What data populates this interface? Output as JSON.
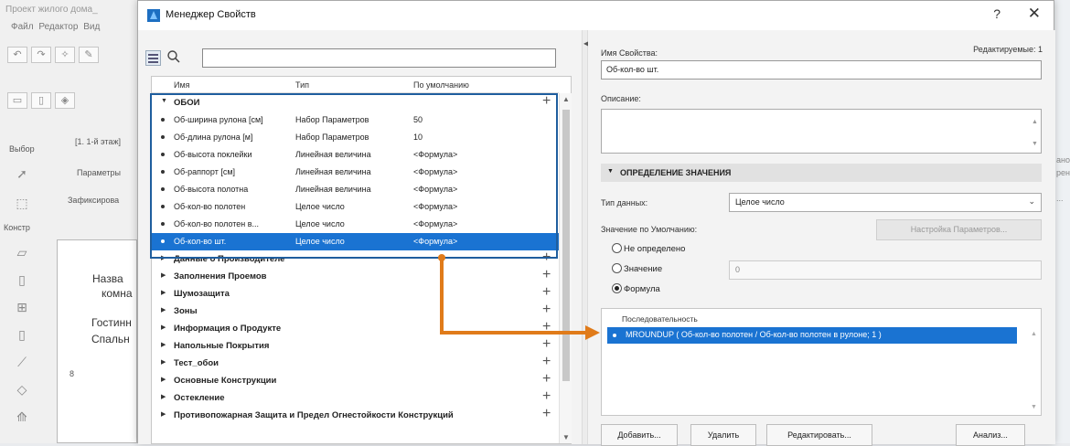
{
  "background": {
    "title": "Проект жилого дома_",
    "menu": "Файл  Редактор  Вид",
    "toolbar_icons": [
      "undo-icon",
      "redo-icon",
      "magic-wand-icon",
      "pencil-icon"
    ],
    "select_label": "Выбор",
    "floor_label": "[1. 1-й этаж]",
    "params_label": "Параметры",
    "fixed_label": "Зафиксирова",
    "construct_label": "Констр",
    "room_name_label": "Назва",
    "room_label2": "комна",
    "table_val1": "Гостинн",
    "table_val2": "Спальн",
    "right_edge_text1": "ано",
    "right_edge_text2": "рени",
    "right_edge_text3": "...",
    "digit": "8"
  },
  "dialog": {
    "title": "Менеджер Свойств",
    "help_label": "?",
    "close_label": "✕"
  },
  "left": {
    "search_placeholder": "",
    "columns": {
      "name": "Имя",
      "type": "Тип",
      "default": "По умолчанию"
    },
    "open_group": "ОБОИ",
    "rows": [
      {
        "name": "Об-ширина рулона [см]",
        "type": "Набор Параметров",
        "default": "50"
      },
      {
        "name": "Об-длина рулона [м]",
        "type": "Набор Параметров",
        "default": "10"
      },
      {
        "name": "Об-высота поклейки",
        "type": "Линейная величина",
        "default": "<Формула>"
      },
      {
        "name": "Об-раппорт [см]",
        "type": "Линейная величина",
        "default": "<Формула>"
      },
      {
        "name": "Об-высота полотна",
        "type": "Линейная величина",
        "default": "<Формула>"
      },
      {
        "name": "Об-кол-во полотен",
        "type": "Целое число",
        "default": "<Формула>"
      },
      {
        "name": "Об-кол-во полотен в...",
        "type": "Целое число",
        "default": "<Формула>"
      },
      {
        "name": "Об-кол-во шт.",
        "type": "Целое число",
        "default": "<Формула>"
      }
    ],
    "groups": [
      "Данные о Производителе",
      "Заполнения Проемов",
      "Шумозащита",
      "Зоны",
      "Информация о Продукте",
      "Напольные Покрытия",
      "Тест_обои",
      "Основные Конструкции",
      "Остекление",
      "Противопожарная Защита и Предел Огнестойкости Конструкций"
    ]
  },
  "right": {
    "name_label": "Имя Свойства:",
    "editable_label": "Редактируемые: 1",
    "name_value": "Об-кол-во шт.",
    "description_label": "Описание:",
    "section_title": "ОПРЕДЕЛЕНИЕ ЗНАЧЕНИЯ",
    "datatype_label": "Тип данных:",
    "datatype_value": "Целое число",
    "default_label": "Значение по Умолчанию:",
    "param_settings_button": "Настройка Параметров...",
    "radio_undefined": "Не определено",
    "radio_value": "Значение",
    "value_field": "0",
    "radio_formula": "Формула",
    "sequence_label": "Последовательность",
    "formula": "MROUNDUP ( Об-кол-во полотен / Об-кол-во полотен в рулоне; 1 )",
    "buttons": {
      "add": "Добавить...",
      "delete": "Удалить",
      "edit": "Редактировать...",
      "analyze": "Анализ..."
    }
  },
  "colors": {
    "selection": "#1a73d2",
    "highlight_frame": "#1f5e9e",
    "annotation_arrow": "#e07b1a"
  }
}
